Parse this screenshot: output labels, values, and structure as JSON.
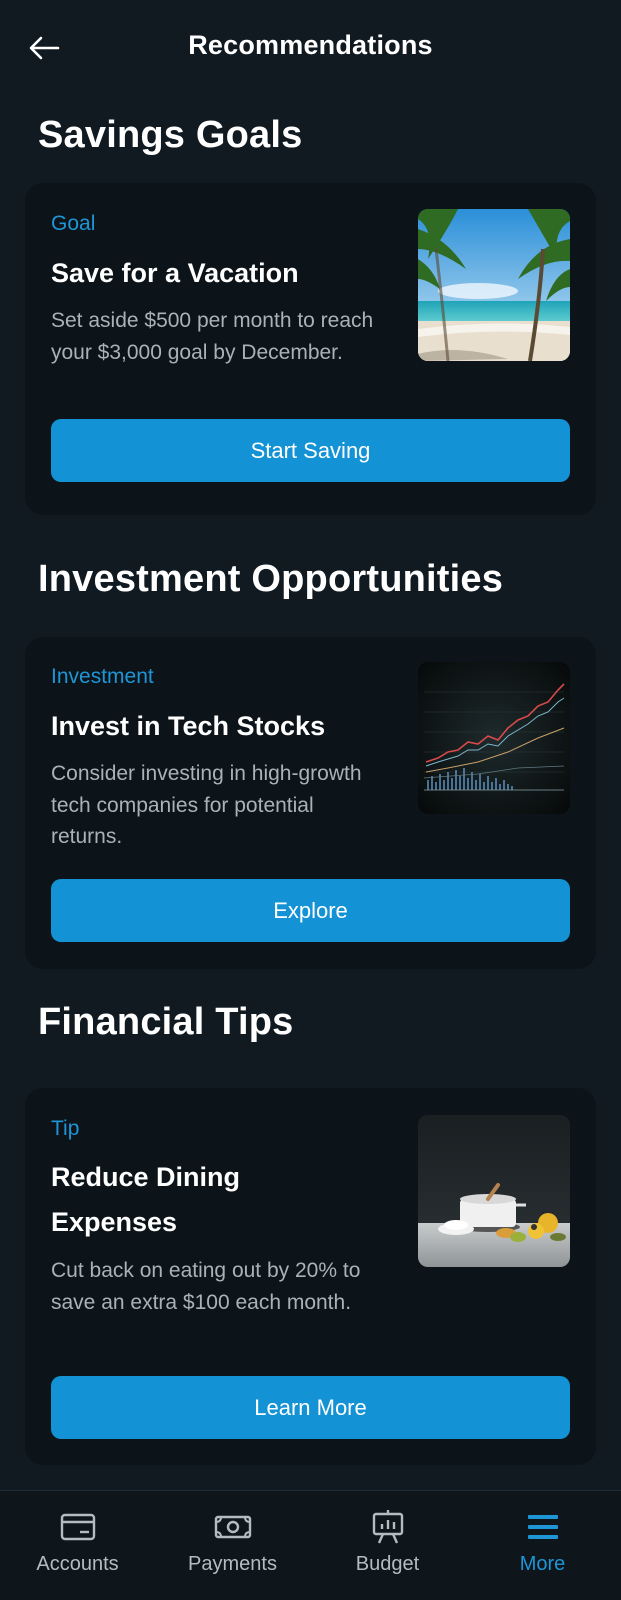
{
  "header": {
    "title": "Recommendations",
    "back_icon": "arrow-left-icon"
  },
  "sections": [
    {
      "title": "Savings Goals",
      "card": {
        "tag": "Goal",
        "title": "Save for a Vacation",
        "description": "Set aside $500 per month to reach your $3,000 goal by December.",
        "button": "Start Saving",
        "image": "beach-vacation-image"
      }
    },
    {
      "title": "Investment Opportunities",
      "card": {
        "tag": "Investment",
        "title": "Invest in Tech Stocks",
        "description": "Consider investing in high-growth tech companies for potential returns.",
        "button": "Explore",
        "image": "stock-chart-image"
      }
    },
    {
      "title": "Financial Tips",
      "card": {
        "tag": "Tip",
        "title": "Reduce Dining Expenses",
        "description": "Cut back on eating out by 20% to save an extra $100 each month.",
        "button": "Learn More",
        "image": "kitchen-cooking-image"
      }
    }
  ],
  "bottom_nav": {
    "items": [
      {
        "label": "Accounts",
        "icon": "credit-card-icon",
        "active": false
      },
      {
        "label": "Payments",
        "icon": "cash-icon",
        "active": false
      },
      {
        "label": "Budget",
        "icon": "presentation-chart-icon",
        "active": false
      },
      {
        "label": "More",
        "icon": "menu-icon",
        "active": true
      }
    ]
  },
  "colors": {
    "background": "#111a21",
    "card": "#0d1419",
    "accent": "#1392d6",
    "tag": "#1e95d6",
    "muted_text": "#a8b2ba"
  }
}
